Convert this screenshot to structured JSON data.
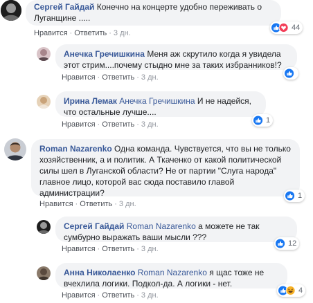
{
  "actions": {
    "like": "Нравится",
    "reply": "Ответить",
    "sep": "·"
  },
  "comments": [
    {
      "author": "Сергей Гайдай",
      "text": "Конечно на концерте удобно переживать о Луганщине .....",
      "time": "3 дн.",
      "reactions": {
        "types": [
          "like",
          "love"
        ],
        "count": "44"
      }
    },
    {
      "author": "Анечка Гречишкина",
      "text": "Меня аж скрутило когда я увидела этот стрим....почему стыдно мне за таких избранников!?",
      "time": "3 дн.",
      "reactions": {
        "types": [
          "like"
        ],
        "count": ""
      }
    },
    {
      "author": "Ирина Лемак",
      "mention": "Анечка Гречишкина",
      "text": "И не надейся, что остальные лучше....",
      "time": "3 дн.",
      "reactions": {
        "types": [
          "like"
        ],
        "count": "1"
      }
    },
    {
      "author": "Roman Nazarenko",
      "text": "Одна команда. Чувствуется, что вы не только хозяйственник, а и политик. А Ткаченко от какой политической силы шел в Луганской области? Не от партии \"Слуга народа\" главное лицо, которой вас сюда поставило главой администрации?",
      "time": "3 дн.",
      "reactions": {
        "types": [
          "like"
        ],
        "count": "1"
      }
    },
    {
      "author": "Сергей Гайдай",
      "mention": "Roman Nazarenko",
      "text": "а можете не так сумбурно выражать ваши мысли ???",
      "time": "3 дн.",
      "reactions": {
        "types": [
          "like"
        ],
        "count": "12"
      }
    },
    {
      "author": "Анна Николаенко",
      "mention": "Roman Nazarenko",
      "text": "я щас тоже не вчехлила логики. Подкол-да. А логики - нет.",
      "time": "3 дн.",
      "reactions": {
        "types": [
          "like",
          "haha"
        ],
        "count": "4"
      }
    }
  ],
  "colors": {
    "link": "#385898",
    "bubble": "#f2f3f5",
    "like": "#1877f2",
    "love": "#f33e58",
    "haha": "#f7b125"
  }
}
